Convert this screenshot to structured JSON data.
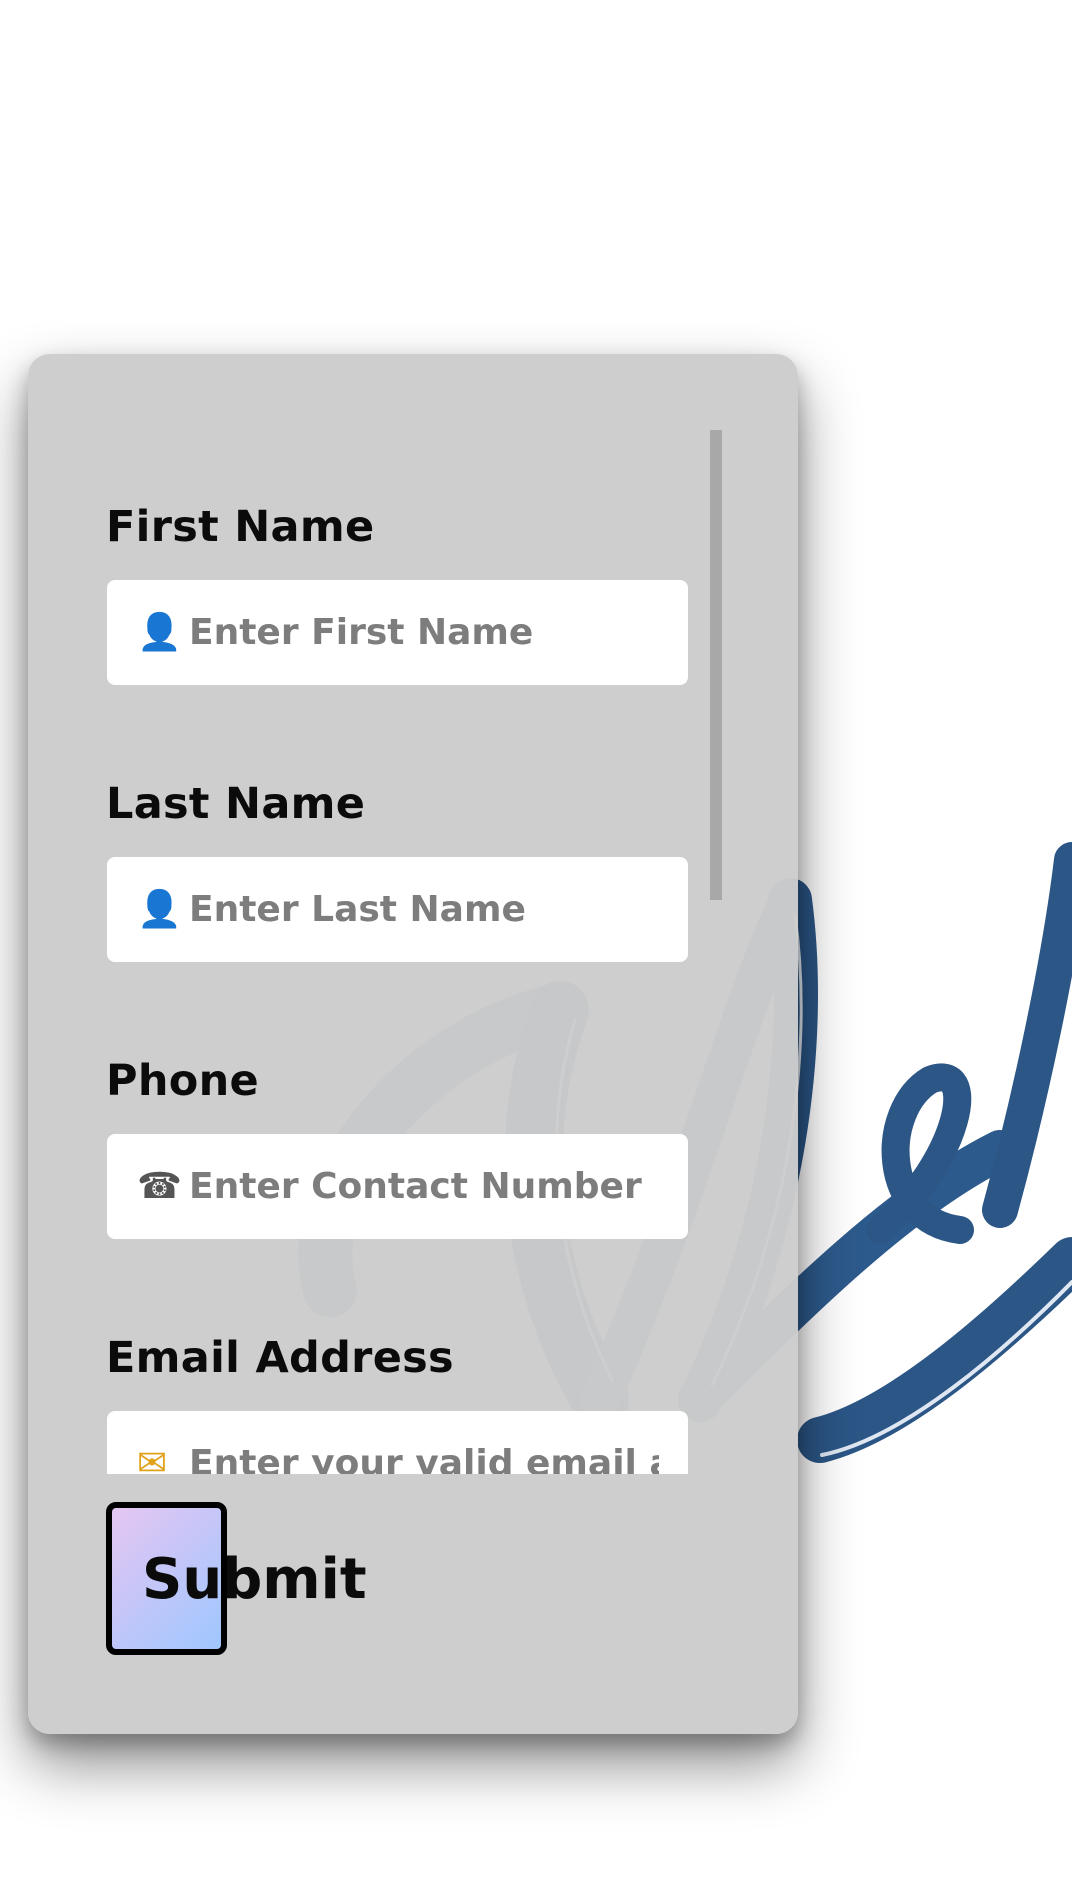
{
  "form": {
    "fields": [
      {
        "label": "First Name",
        "placeholder": "Enter First Name",
        "icon": "person-icon",
        "glyph": "👤"
      },
      {
        "label": "Last Name",
        "placeholder": "Enter Last Name",
        "icon": "person-icon",
        "glyph": "👤"
      },
      {
        "label": "Phone",
        "placeholder": "Enter Contact Number",
        "icon": "phone-icon",
        "glyph": "☎"
      },
      {
        "label": "Email Address",
        "placeholder": "Enter your valid email address",
        "icon": "envelope-icon",
        "glyph": "✉"
      }
    ],
    "submit_label": "Submit"
  },
  "background": {
    "script_text": "Welcome",
    "script_color": "#2b5686"
  },
  "colors": {
    "card": "#cccccc",
    "input": "#ffffff",
    "placeholder": "#7d7d7d",
    "button_gradient_start": "#e6c6f2",
    "button_gradient_end": "#9ec7ff"
  }
}
